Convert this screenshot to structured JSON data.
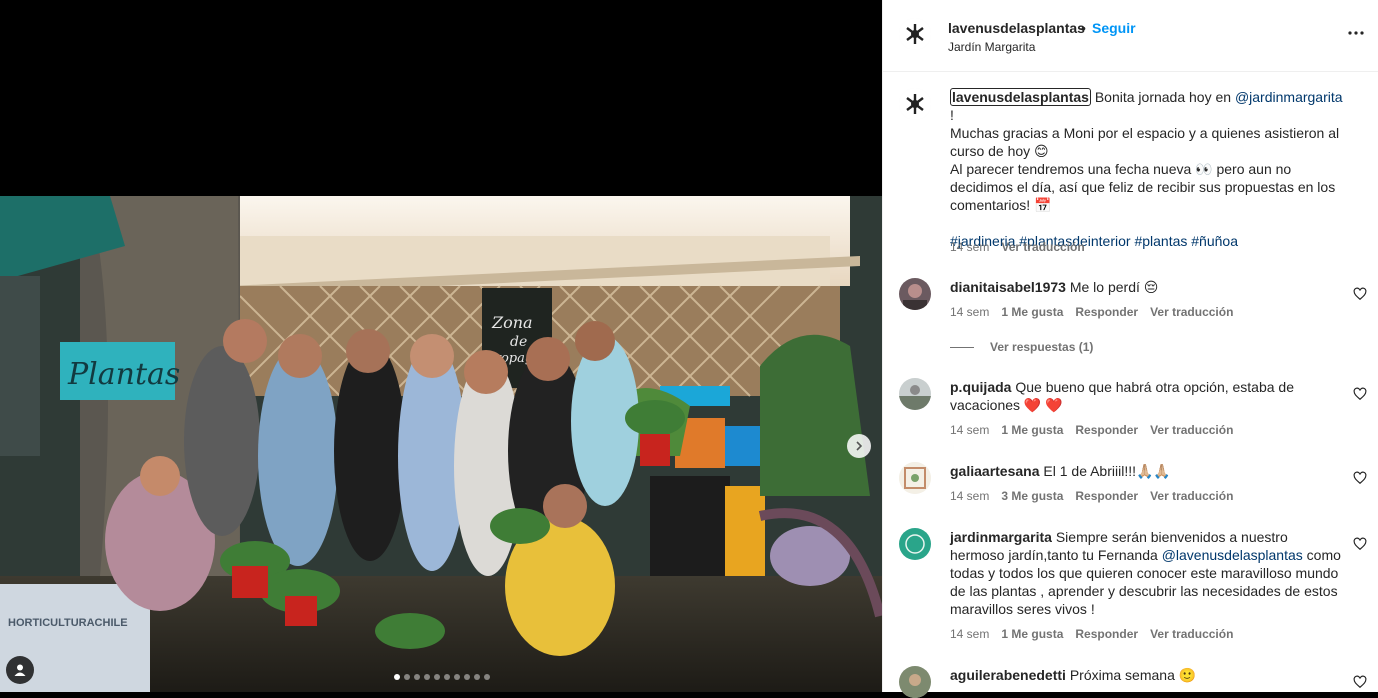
{
  "post": {
    "author": "lavenusdelasplantas",
    "follow_label": "Seguir",
    "location": "Jardín Margarita",
    "separator": "•"
  },
  "caption": {
    "user": "lavenusdelasplantas",
    "line1_pre": " Bonita jornada hoy en ",
    "mention": "@jardinmargarita",
    "line1_post": " !",
    "line2": "Muchas gracias a Moni por el espacio y a quienes asistieron al curso de hoy 😊",
    "line3": "Al parecer tendremos una fecha nueva 👀 pero aun no decidimos el día, así que feliz de recibir sus propuestas en los comentarios! 📅",
    "hashtags": "#jardineria #plantasdeinterior #plantas #ñuñoa",
    "time": "14 sem",
    "translate": "Ver traducción"
  },
  "comments": [
    {
      "user": "dianitaisabel1973",
      "text": "Me lo perdí 😔",
      "time": "14 sem",
      "likes": "1 Me gusta",
      "reply": "Responder",
      "translate": "Ver traducción"
    },
    {
      "user": "p.quijada",
      "text": "Que bueno que habrá otra opción, estaba de vacaciones ❤️ ❤️",
      "time": "14 sem",
      "likes": "1 Me gusta",
      "reply": "Responder",
      "translate": "Ver traducción"
    },
    {
      "user": "galiaartesana",
      "text": "El 1 de Abriiil!!!🙏🏼🙏🏼",
      "time": "14 sem",
      "likes": "3 Me gusta",
      "reply": "Responder",
      "translate": "Ver traducción"
    },
    {
      "user": "jardinmargarita",
      "text_pre": "Siempre serán bienvenidos a nuestro hermoso jardín,tanto tu Fernanda ",
      "mention": "@lavenusdelasplantas",
      "text_post": " como todas y todos los que quieren conocer este maravilloso mundo de las plantas , aprender y descubrir las necesidades de estos maravillos seres vivos !",
      "time": "14 sem",
      "likes": "1 Me gusta",
      "reply": "Responder",
      "translate": "Ver traducción"
    },
    {
      "user": "aguilerabenedetti",
      "text": "Próxima semana 🙂"
    }
  ],
  "replies_label": "Ver respuestas (1)",
  "photo": {
    "sign_text": "Plantas",
    "board_text_1": "Zona",
    "board_text_2": "de",
    "board_text_3": "Propag",
    "banner_text": "HORTICULTURACHILE"
  },
  "carousel": {
    "count": 10,
    "active": 0
  },
  "colors": {
    "follow": "#0095f6",
    "mention": "#00376b",
    "meta": "#737373",
    "like": "#ed4956"
  }
}
